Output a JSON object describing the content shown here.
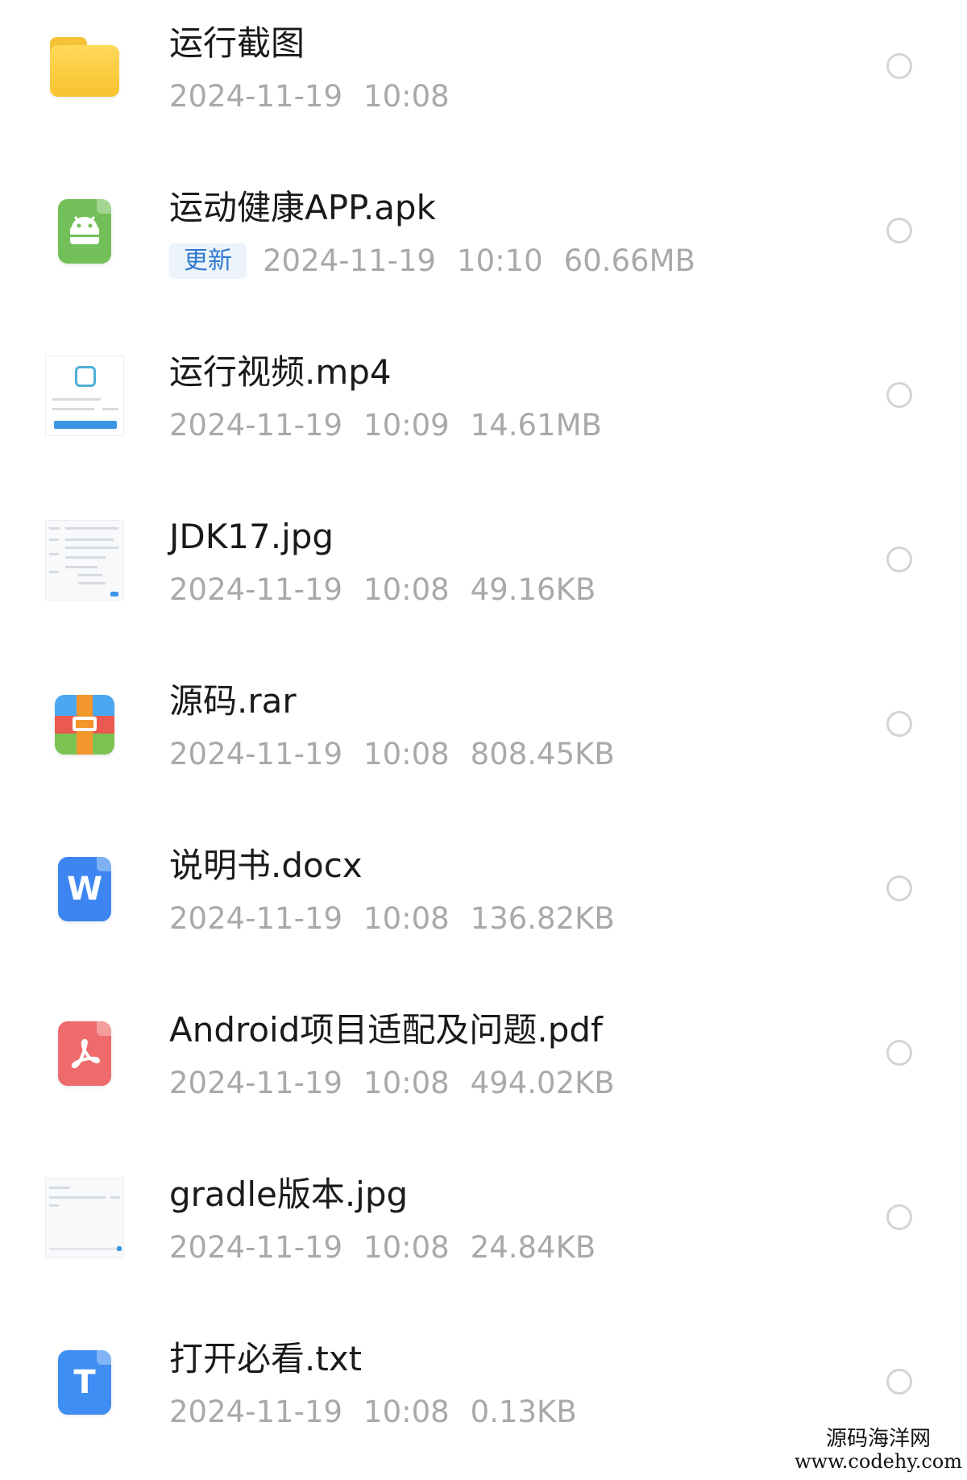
{
  "files": [
    {
      "name": "运行截图",
      "date": "2024-11-19",
      "time": "10:08",
      "size": "",
      "badge": "",
      "icon": "folder-icon"
    },
    {
      "name": "运动健康APP.apk",
      "date": "2024-11-19",
      "time": "10:10",
      "size": "60.66MB",
      "badge": "更新",
      "icon": "android-apk-icon"
    },
    {
      "name": "运行视频.mp4",
      "date": "2024-11-19",
      "time": "10:09",
      "size": "14.61MB",
      "badge": "",
      "icon": "video-thumbnail"
    },
    {
      "name": "JDK17.jpg",
      "date": "2024-11-19",
      "time": "10:08",
      "size": "49.16KB",
      "badge": "",
      "icon": "image-thumbnail"
    },
    {
      "name": "源码.rar",
      "date": "2024-11-19",
      "time": "10:08",
      "size": "808.45KB",
      "badge": "",
      "icon": "archive-icon"
    },
    {
      "name": "说明书.docx",
      "date": "2024-11-19",
      "time": "10:08",
      "size": "136.82KB",
      "badge": "",
      "icon": "word-doc-icon"
    },
    {
      "name": "Android项目适配及问题.pdf",
      "date": "2024-11-19",
      "time": "10:08",
      "size": "494.02KB",
      "badge": "",
      "icon": "pdf-icon"
    },
    {
      "name": "gradle版本.jpg",
      "date": "2024-11-19",
      "time": "10:08",
      "size": "24.84KB",
      "badge": "",
      "icon": "image-thumbnail"
    },
    {
      "name": "打开必看.txt",
      "date": "2024-11-19",
      "time": "10:08",
      "size": "0.13KB",
      "badge": "",
      "icon": "text-file-icon"
    }
  ],
  "icon_glyphs": {
    "doc": "W",
    "txt": "T",
    "pdf": "⅄"
  },
  "colors": {
    "badge_text": "#2f79d2",
    "badge_bg": "#edf3fa",
    "meta_text": "#a9a9a9",
    "name_text": "#1a1a1a"
  },
  "watermark": {
    "line1": "源码海洋网",
    "line2": "www.codehy.com"
  }
}
